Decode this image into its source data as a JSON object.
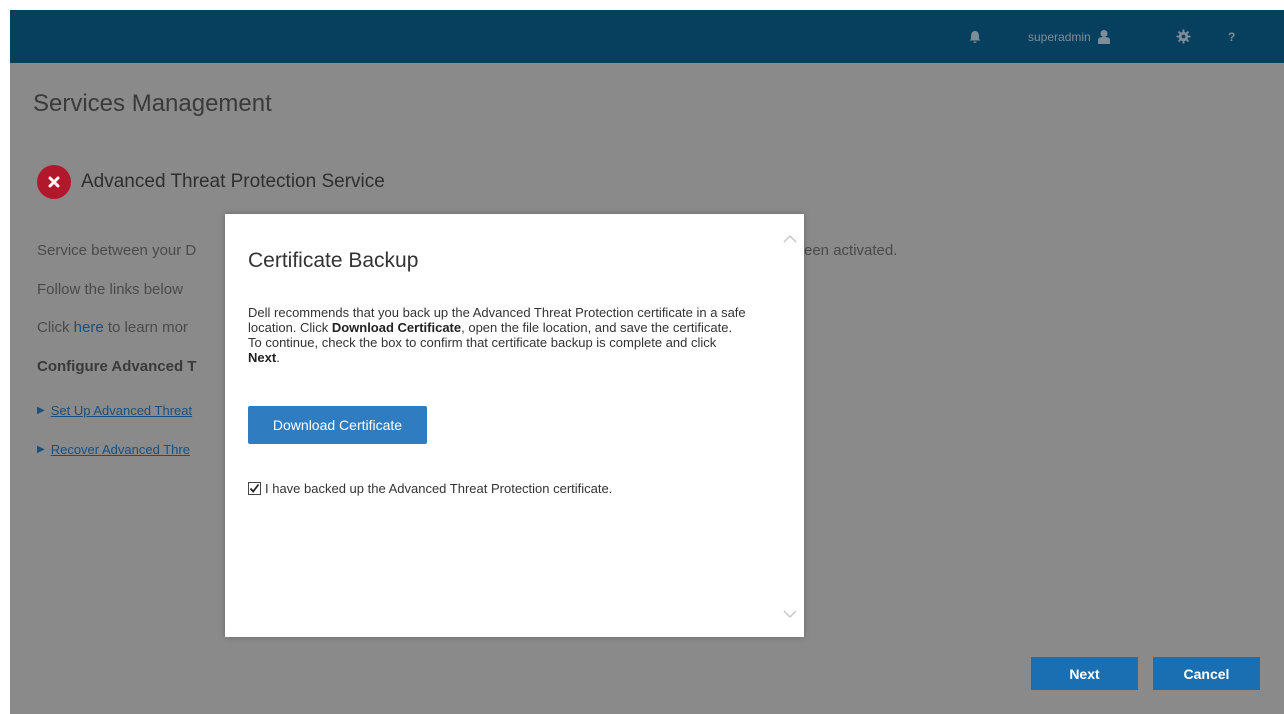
{
  "header": {
    "username": "superadmin",
    "help_label": "?"
  },
  "page": {
    "title": "Services Management"
  },
  "service": {
    "name": "Advanced Threat Protection Service",
    "status_color": "#b2182b",
    "line1": "Service between your D",
    "line1_right": "een activated.",
    "line2": "Follow the links below",
    "line3_prefix": "Click ",
    "line3_link": "here",
    "line3_suffix": " to learn mor",
    "section_heading": "Configure Advanced T",
    "links": [
      {
        "label": "Set Up Advanced Threat"
      },
      {
        "label": "Recover Advanced Thre"
      }
    ]
  },
  "footer": {
    "next_label": "Next",
    "cancel_label": "Cancel"
  },
  "modal": {
    "title": "Certificate Backup",
    "desc_part1": "Dell recommends that you back up the Advanced Threat Protection certificate in a safe location. Click ",
    "desc_bold1": "Download Certificate",
    "desc_part2": ", open the file location, and save the certificate. To continue, check the box to confirm that certificate backup is complete and click ",
    "desc_bold2": "Next",
    "desc_part3": ".",
    "download_label": "Download Certificate",
    "checkbox_label": "I have backed up the Advanced Threat Protection certificate.",
    "checkbox_checked": true
  },
  "colors": {
    "topbar": "#073f5e",
    "overlay_bg": "#8a8a8a",
    "primary_button": "#1a6fb3",
    "download_button": "#2f7cc0"
  }
}
